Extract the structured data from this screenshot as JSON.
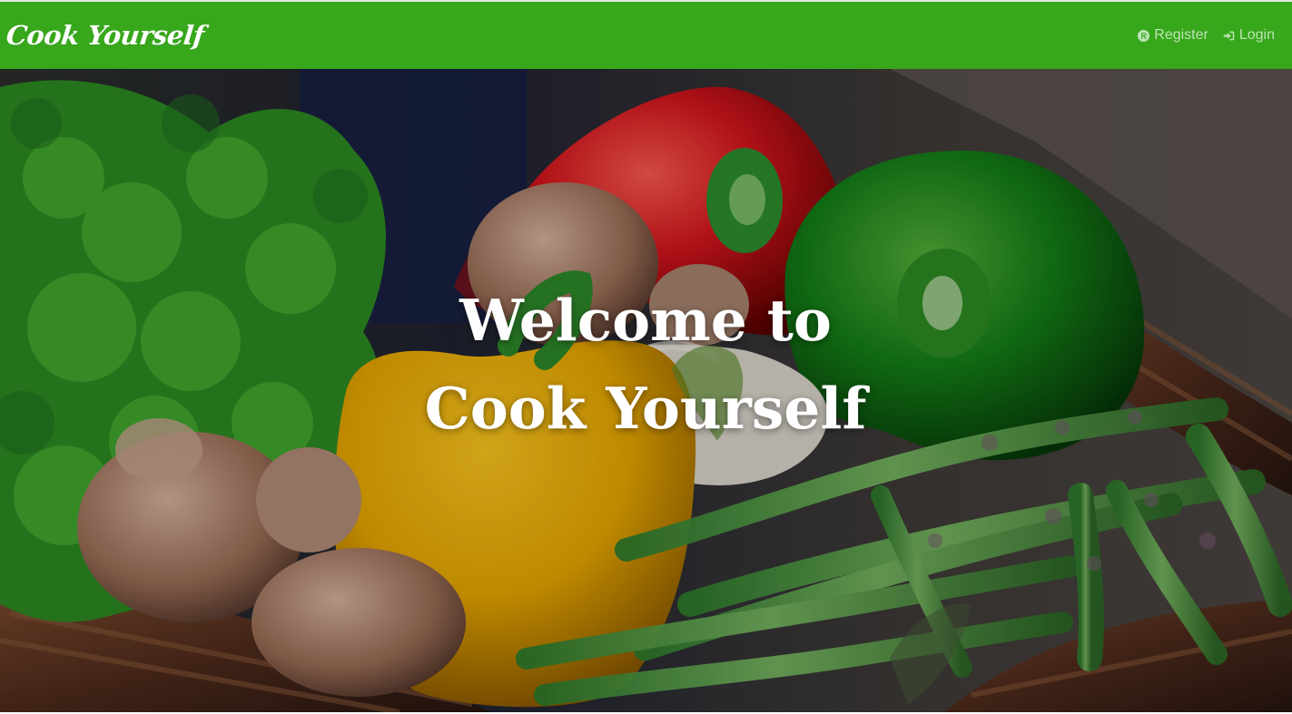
{
  "navbar": {
    "brand": "Cook Yourself",
    "register_label": "Register",
    "login_label": "Login",
    "background_color": "#37a81b",
    "register_icon": "register-icon",
    "login_icon": "sign-in-icon"
  },
  "hero": {
    "title": "Welcome to Cook Yourself",
    "image": "vegetable-basket-photo"
  }
}
